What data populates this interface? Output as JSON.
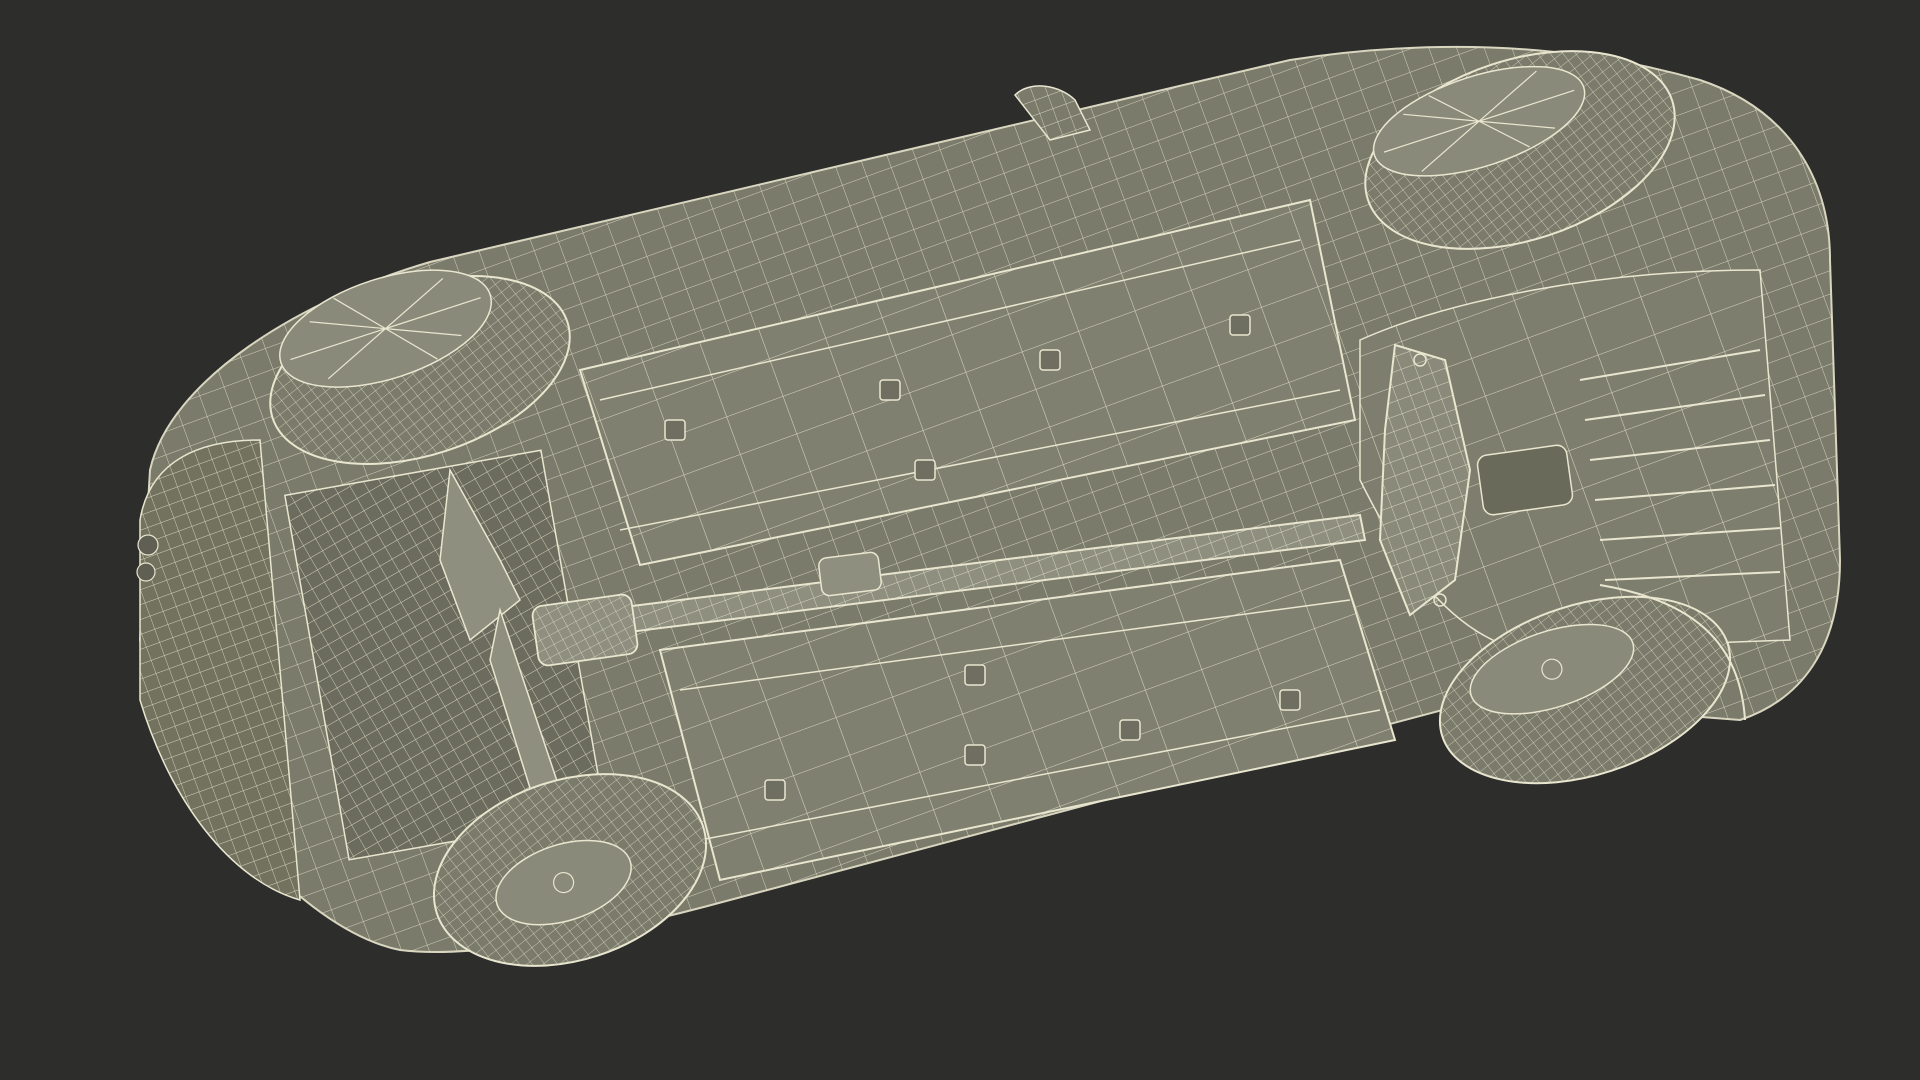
{
  "scene": {
    "subject": "car-underside-wireframe-render",
    "colors": {
      "background": "#2d2d2c",
      "surface": "#7b7b6c",
      "surface_dark": "#5f5f53",
      "surface_light": "#8f8f80",
      "wire": "#e9e6cf",
      "wire_dim": "#c9c6ae"
    }
  }
}
